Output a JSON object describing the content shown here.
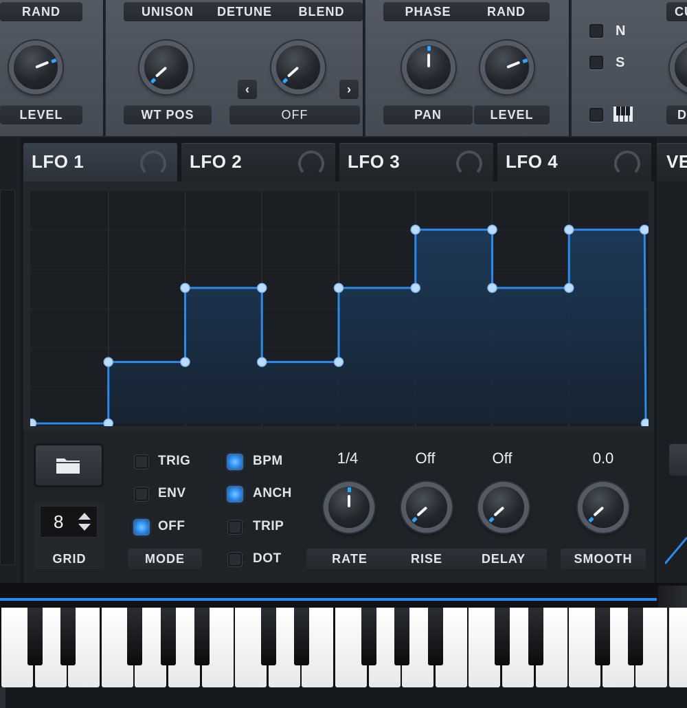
{
  "osc_strip": {
    "labels": {
      "rand_top": "RAND",
      "level_left": "LEVEL",
      "unison": "UNISON",
      "detune": "DETUNE",
      "blend": "BLEND",
      "wt_pos": "WT POS",
      "warp_mode": "OFF",
      "phase": "PHASE",
      "rand2": "RAND",
      "pan": "PAN",
      "level2": "LEVEL",
      "cu_partial": "CU",
      "d_partial": "D"
    },
    "side_options": [
      "N",
      "S"
    ],
    "piano_icon": "piano-keys-icon"
  },
  "lfo_tabs": [
    "LFO 1",
    "LFO 2",
    "LFO 3",
    "LFO 4",
    "VE"
  ],
  "active_tab": 0,
  "accent_color": "#2a8bee",
  "lfo": {
    "shape_points": [
      [
        0.0,
        0.0
      ],
      [
        0.125,
        0.0
      ],
      [
        0.125,
        0.29
      ],
      [
        0.25,
        0.29
      ],
      [
        0.25,
        0.64
      ],
      [
        0.375,
        0.64
      ],
      [
        0.375,
        0.29
      ],
      [
        0.5,
        0.29
      ],
      [
        0.5,
        0.64
      ],
      [
        0.625,
        0.64
      ],
      [
        0.625,
        0.915
      ],
      [
        0.75,
        0.915
      ],
      [
        0.75,
        0.64
      ],
      [
        0.875,
        0.64
      ],
      [
        0.875,
        0.915
      ],
      [
        0.998,
        0.915
      ],
      [
        1.0,
        0.0
      ]
    ],
    "grid_value": "8",
    "grid_label": "GRID",
    "mode_label": "MODE",
    "options": [
      {
        "label": "TRIG",
        "on": false
      },
      {
        "label": "ENV",
        "on": false
      },
      {
        "label": "OFF",
        "on": true
      },
      {
        "label": "BPM",
        "on": true
      },
      {
        "label": "ANCH",
        "on": true
      },
      {
        "label": "TRIP",
        "on": false
      },
      {
        "label": "DOT",
        "on": false
      }
    ],
    "knobs": {
      "rate": {
        "label": "RATE",
        "value": "1/4"
      },
      "rise": {
        "label": "RISE",
        "value": "Off"
      },
      "delay": {
        "label": "DELAY",
        "value": "Off"
      },
      "smooth": {
        "label": "SMOOTH",
        "value": "0.0"
      }
    }
  }
}
